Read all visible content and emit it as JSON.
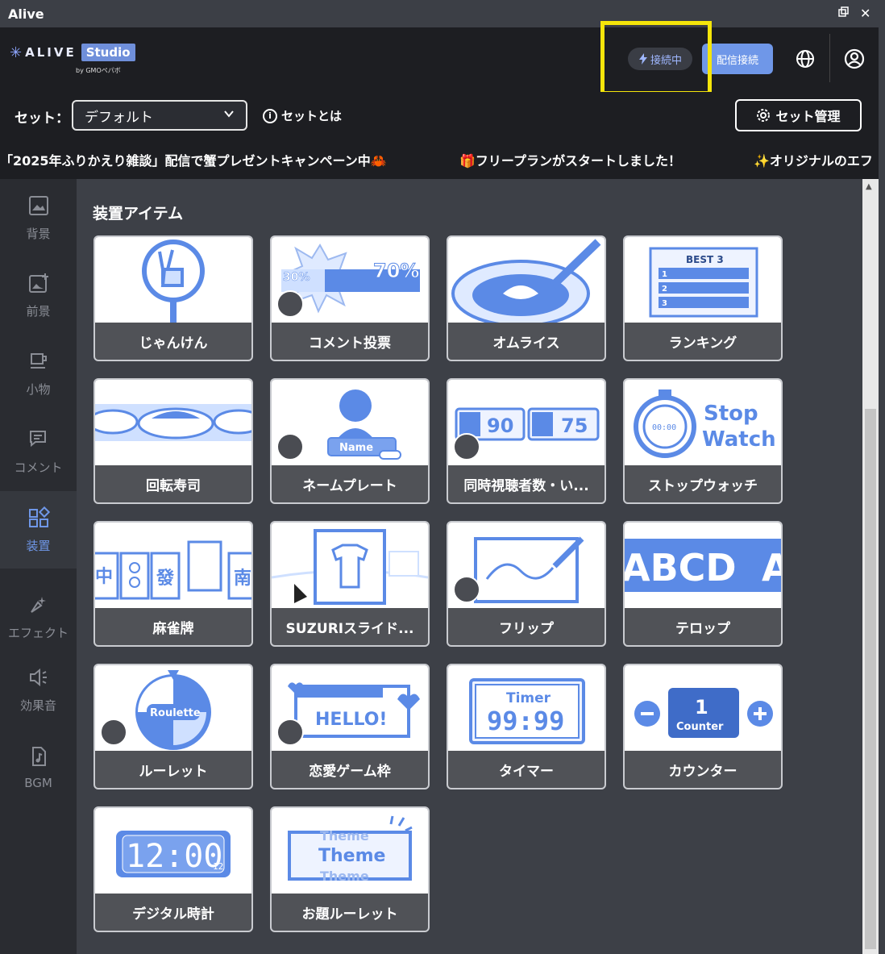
{
  "window": {
    "title": "Alive",
    "restore_icon": "restore-icon",
    "close_label": "✕"
  },
  "header": {
    "logo_text": "ALIVE",
    "logo_studio": "Studio",
    "logo_sub": "by GMOペパボ",
    "conn_status": "接続中",
    "stream_connect_label": "配信接続",
    "highlight_color": "#f5e50a",
    "accent": "#6f97e8"
  },
  "setbar": {
    "label": "セット：",
    "selected": "デフォルト",
    "help": "セットとは",
    "manage": "セット管理"
  },
  "ticker": [
    "「2025年ふりかえり雑談」配信で蟹プレゼントキャンペーン中🦀",
    "🎁フリープランがスタートしました！",
    "✨オリジナルのエフ"
  ],
  "sidebar": [
    {
      "label": "背景",
      "icon": "image-icon"
    },
    {
      "label": "前景",
      "icon": "image-plus-icon"
    },
    {
      "label": "小物",
      "icon": "cup-icon"
    },
    {
      "label": "コメント",
      "icon": "comment-icon"
    },
    {
      "label": "装置",
      "icon": "widgets-icon",
      "active": true
    },
    {
      "label": "エフェクト",
      "icon": "sparkle-icon"
    },
    {
      "label": "効果音",
      "icon": "speaker-icon"
    },
    {
      "label": "BGM",
      "icon": "music-file-icon"
    }
  ],
  "main": {
    "section_title": "装置アイテム",
    "items": [
      {
        "label": "じゃんけん",
        "premium": false
      },
      {
        "label": "コメント投票",
        "premium": true,
        "thumb_texts": [
          "30%",
          "70%"
        ]
      },
      {
        "label": "オムライス",
        "premium": false
      },
      {
        "label": "ランキング",
        "premium": false,
        "thumb_texts": [
          "BEST 3",
          "1",
          "2",
          "3"
        ]
      },
      {
        "label": "回転寿司",
        "premium": false
      },
      {
        "label": "ネームプレート",
        "premium": true,
        "thumb_texts": [
          "Name"
        ]
      },
      {
        "label": "同時視聴者数・い...",
        "premium": true,
        "thumb_texts": [
          "90",
          "75"
        ]
      },
      {
        "label": "ストップウォッチ",
        "premium": false,
        "thumb_texts": [
          "Stop",
          "Watch",
          "00:00"
        ]
      },
      {
        "label": "麻雀牌",
        "premium": false,
        "thumb_texts": [
          "中",
          "發",
          "南"
        ]
      },
      {
        "label": "SUZURIスライド...",
        "premium": false
      },
      {
        "label": "フリップ",
        "premium": true
      },
      {
        "label": "テロップ",
        "premium": false,
        "thumb_texts": [
          "ABCD",
          "A"
        ]
      },
      {
        "label": "ルーレット",
        "premium": true,
        "thumb_texts": [
          "Roulette"
        ]
      },
      {
        "label": "恋愛ゲーム枠",
        "premium": true,
        "thumb_texts": [
          "HELLO!"
        ]
      },
      {
        "label": "タイマー",
        "premium": false,
        "thumb_texts": [
          "Timer",
          "99:99"
        ]
      },
      {
        "label": "カウンター",
        "premium": false,
        "thumb_texts": [
          "1",
          "Counter"
        ]
      },
      {
        "label": "デジタル時計",
        "premium": false,
        "thumb_texts": [
          "12:00",
          "12"
        ]
      },
      {
        "label": "お題ルーレット",
        "premium": false,
        "thumb_texts": [
          "Theme",
          "Theme",
          "Theme"
        ]
      }
    ]
  }
}
